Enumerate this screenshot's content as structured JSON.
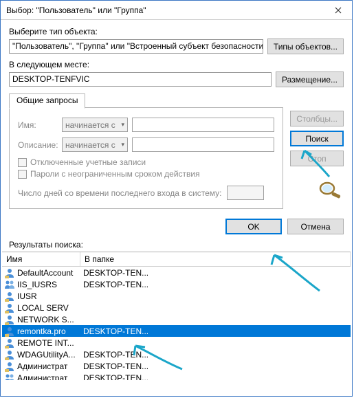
{
  "window": {
    "title": "Выбор: \"Пользователь\" или \"Группа\""
  },
  "section_object_type": {
    "label": "Выберите тип объекта:",
    "value": "\"Пользователь\", \"Группа\" или \"Встроенный субъект безопасности\"",
    "button": "Типы объектов..."
  },
  "section_location": {
    "label": "В следующем месте:",
    "value": "DESKTOP-TENFVIC",
    "button": "Размещение..."
  },
  "tab": {
    "label": "Общие запросы"
  },
  "common_queries": {
    "name_label": "Имя:",
    "name_combo": "начинается с",
    "desc_label": "Описание:",
    "desc_combo": "начинается с",
    "chk_disabled": "Отключенные учетные записи",
    "chk_nonexp": "Пароли с неограниченным сроком действия",
    "days_label": "Число дней со времени последнего входа в систему:"
  },
  "right_buttons": {
    "columns": "Столбцы...",
    "find": "Поиск",
    "stop": "Стоп"
  },
  "ok_row": {
    "ok": "OK",
    "cancel": "Отмена"
  },
  "results": {
    "label": "Результаты поиска:",
    "col_name": "Имя",
    "col_folder": "В папке",
    "rows": [
      {
        "icon": "user",
        "name": "DefaultAccount",
        "folder": "DESKTOP-TEN...",
        "selected": false
      },
      {
        "icon": "group",
        "name": "IIS_IUSRS",
        "folder": "DESKTOP-TEN...",
        "selected": false
      },
      {
        "icon": "user",
        "name": "IUSR",
        "folder": "",
        "selected": false
      },
      {
        "icon": "user",
        "name": "LOCAL SERV",
        "folder": "",
        "selected": false
      },
      {
        "icon": "user",
        "name": "NETWORK S...",
        "folder": "",
        "selected": false
      },
      {
        "icon": "user",
        "name": "remontka.pro",
        "folder": "DESKTOP-TEN...",
        "selected": true
      },
      {
        "icon": "user",
        "name": "REMOTE INT...",
        "folder": "",
        "selected": false
      },
      {
        "icon": "user",
        "name": "WDAGUtilityA...",
        "folder": "DESKTOP-TEN...",
        "selected": false
      },
      {
        "icon": "user",
        "name": "Администрат",
        "folder": "DESKTOP-TEN...",
        "selected": false
      },
      {
        "icon": "group",
        "name": "Администрат",
        "folder": "DESKTOP-TEN...",
        "selected": false
      }
    ]
  }
}
